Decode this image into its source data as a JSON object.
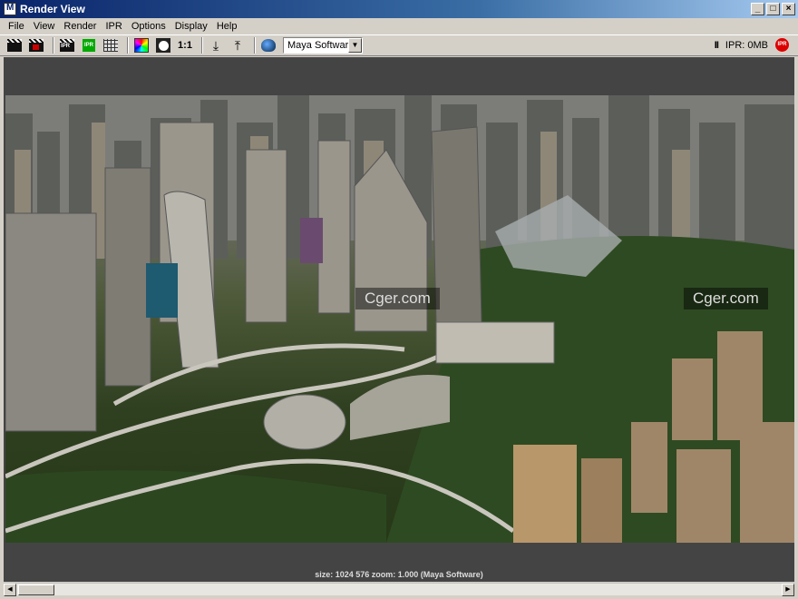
{
  "window": {
    "title": "Render View",
    "controls": [
      "_",
      "□",
      "×"
    ]
  },
  "menu": [
    "File",
    "View",
    "Render",
    "IPR",
    "Options",
    "Display",
    "Help"
  ],
  "toolbar": {
    "one_to_one": "1:1",
    "renderer": "Maya Software",
    "ipr_memory": "IPR: 0MB",
    "ipr_badge": "IPR",
    "pause": "II"
  },
  "viewport": {
    "watermarks": [
      "Cger.com",
      "Cger.com"
    ],
    "status": "size: 1024  576 zoom: 1.000  (Maya Software)"
  }
}
